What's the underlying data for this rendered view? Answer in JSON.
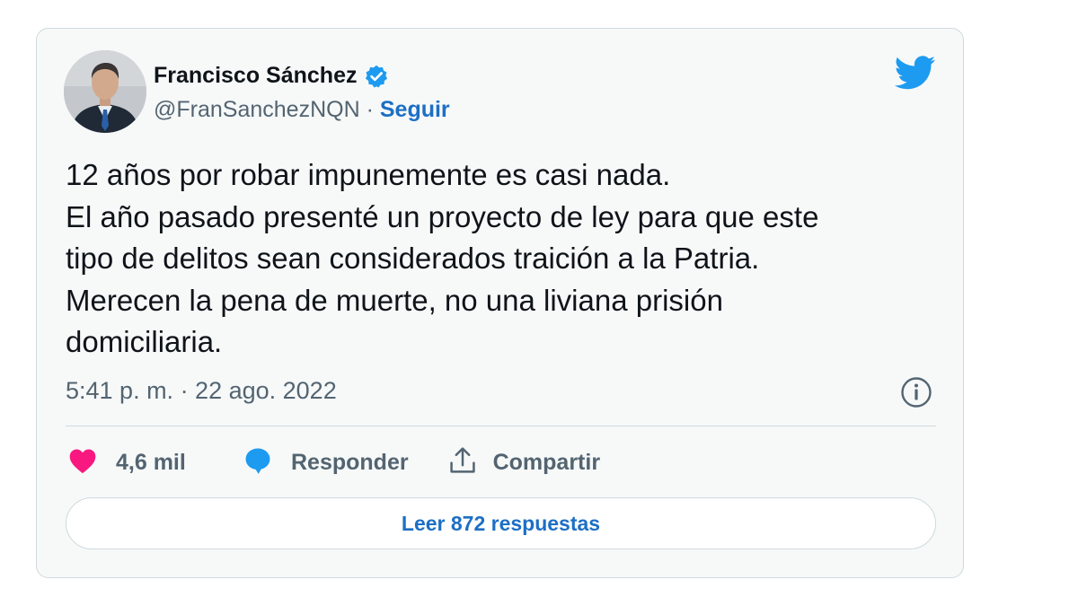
{
  "tweet": {
    "author": {
      "name": "Francisco Sánchez",
      "handle": "@FranSanchezNQN",
      "separator": " · ",
      "follow_label": "Seguir",
      "verified": true
    },
    "text_lines": [
      "12 años por robar impunemente es casi nada.",
      "El año pasado presenté un proyecto de ley para que este",
      "tipo de delitos sean considerados traición a la Patria.",
      "Merecen la pena de muerte, no una liviana prisión",
      "domiciliaria."
    ],
    "timestamp": "5:41 p. m. · 22 ago. 2022",
    "actions": {
      "likes_count": "4,6 mil",
      "reply_label": "Responder",
      "share_label": "Compartir"
    },
    "read_replies_label": "Leer 872 respuestas"
  },
  "colors": {
    "accent": "#1d9bf0",
    "link": "#1d6fc4",
    "like": "#f91880",
    "secondary_text": "#536471",
    "card_background": "#f7f9f9",
    "border": "#cfd9de"
  },
  "icons": [
    "verified-badge-icon",
    "twitter-bird-icon",
    "info-icon",
    "heart-icon",
    "reply-bubble-icon",
    "share-icon"
  ]
}
